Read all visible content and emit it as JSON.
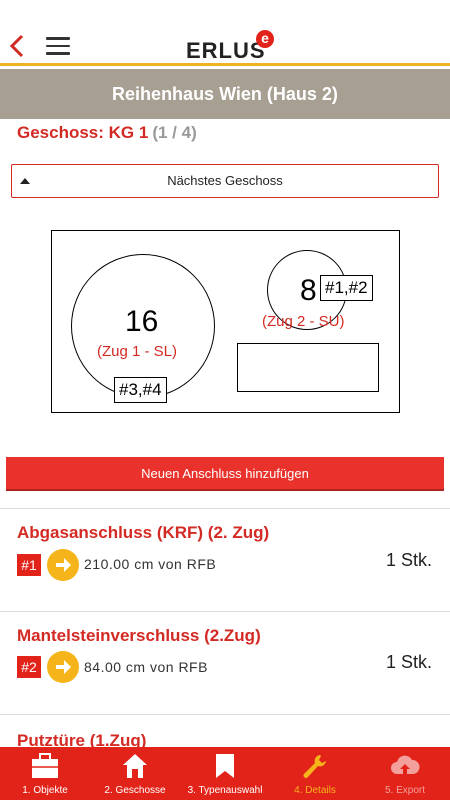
{
  "header": {
    "logo_text": "ERLUS",
    "logo_mark": "e"
  },
  "title": "Reihenhaus Wien (Haus 2)",
  "geschoss": {
    "label": "Geschoss: KG 1",
    "count": "(1 / 4)"
  },
  "next_floor_button": "Nächstes Geschoss",
  "plan": {
    "chimney1": {
      "number": "16",
      "zug": "(Zug 1 - SL)",
      "tag": "#3,#4"
    },
    "chimney2": {
      "number": "8",
      "zug": "(Zug 2 - SU)",
      "tag": "#1,#2"
    }
  },
  "add_button": "Neuen Anschluss hinzufügen",
  "items": [
    {
      "title": "Abgasanschluss (KRF) (2. Zug)",
      "badge": "#1",
      "distance": "210.00 cm von RFB",
      "qty": "1 Stk."
    },
    {
      "title": "Mantelsteinverschluss (2.Zug)",
      "badge": "#2",
      "distance": "84.00 cm von RFB",
      "qty": "1 Stk."
    },
    {
      "title": "Putztüre (1.Zug)"
    }
  ],
  "nav": [
    {
      "label": "1. Objekte",
      "icon": "briefcase-icon"
    },
    {
      "label": "2. Geschosse",
      "icon": "house-icon"
    },
    {
      "label": "3. Typenauswahl",
      "icon": "bookmark-icon"
    },
    {
      "label": "4. Details",
      "icon": "wrench-icon",
      "active": true
    },
    {
      "label": "5. Export",
      "icon": "cloud-upload-icon",
      "disabled": true
    }
  ],
  "colors": {
    "brand_red": "#e2231a",
    "accent_yellow": "#f4b41a",
    "title_bg": "#a89f93"
  }
}
